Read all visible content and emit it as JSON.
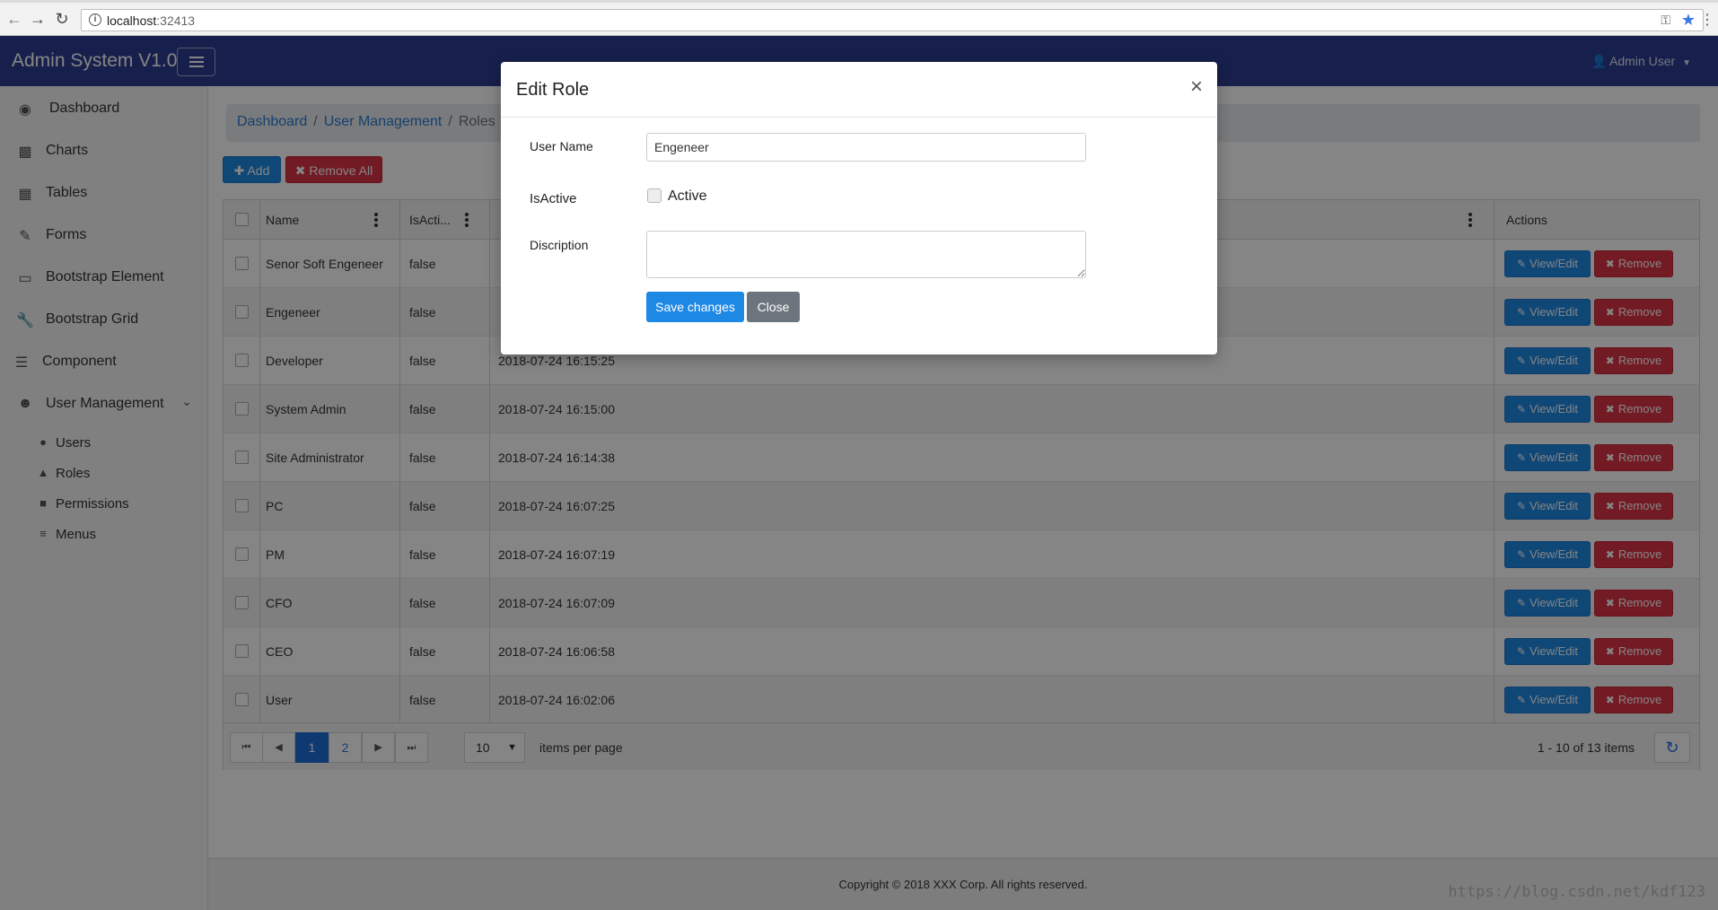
{
  "browser": {
    "url_host": "localhost",
    "url_port": ":32413",
    "back_icon": "back-arrow-icon",
    "forward_icon": "forward-arrow-icon",
    "reload_icon": "reload-icon"
  },
  "header": {
    "brand": "Admin System V1.0",
    "user": "Admin User"
  },
  "sidebar": {
    "items": [
      {
        "label": "Dashboard",
        "icon": "dashboard-icon"
      },
      {
        "label": "Charts",
        "icon": "bar-chart-icon"
      },
      {
        "label": "Tables",
        "icon": "table-icon"
      },
      {
        "label": "Forms",
        "icon": "edit-icon"
      },
      {
        "label": "Bootstrap Element",
        "icon": "desktop-icon"
      },
      {
        "label": "Bootstrap Grid",
        "icon": "wrench-icon"
      },
      {
        "label": "Component",
        "icon": "list-icon"
      },
      {
        "label": "User Management",
        "icon": "users-icon"
      }
    ],
    "subitems": [
      {
        "label": "Users",
        "icon": "user-icon"
      },
      {
        "label": "Roles",
        "icon": "sitemap-icon"
      },
      {
        "label": "Permissions",
        "icon": "lock-icon"
      },
      {
        "label": "Menus",
        "icon": "bars-icon"
      }
    ]
  },
  "breadcrumb": {
    "items": [
      "Dashboard",
      "User Management"
    ],
    "current": "Roles"
  },
  "toolbar": {
    "add_label": "Add",
    "remove_all_label": "Remove All"
  },
  "grid": {
    "columns": [
      "Name",
      "IsActi...",
      "Actions"
    ],
    "rows": [
      {
        "name": "Senor Soft Engeneer",
        "active": "false",
        "created": ""
      },
      {
        "name": "Engeneer",
        "active": "false",
        "created": ""
      },
      {
        "name": "Developer",
        "active": "false",
        "created": "2018-07-24 16:15:25"
      },
      {
        "name": "System Admin",
        "active": "false",
        "created": "2018-07-24 16:15:00"
      },
      {
        "name": "Site Administrator",
        "active": "false",
        "created": "2018-07-24 16:14:38"
      },
      {
        "name": "PC",
        "active": "false",
        "created": "2018-07-24 16:07:25"
      },
      {
        "name": "PM",
        "active": "false",
        "created": "2018-07-24 16:07:19"
      },
      {
        "name": "CFO",
        "active": "false",
        "created": "2018-07-24 16:07:09"
      },
      {
        "name": "CEO",
        "active": "false",
        "created": "2018-07-24 16:06:58"
      },
      {
        "name": "User",
        "active": "false",
        "created": "2018-07-24 16:02:06"
      }
    ],
    "view_edit_label": "View/Edit",
    "remove_label": "Remove"
  },
  "pager": {
    "pages": [
      "1",
      "2"
    ],
    "current_page": "1",
    "page_size": "10",
    "items_per_page_label": "items per page",
    "info": "1 - 10 of 13 items"
  },
  "footer": {
    "copyright": "Copyright © 2018 XXX Corp. All rights reserved.",
    "watermark": "https://blog.csdn.net/kdf123"
  },
  "modal": {
    "title": "Edit Role",
    "close_symbol": "×",
    "user_name_label": "User Name",
    "user_name_value": "Engeneer",
    "is_active_label": "IsActive",
    "active_checkbox_label": "Active",
    "active_checked": false,
    "description_label": "Discription",
    "description_value": "",
    "save_label": "Save changes",
    "close_label": "Close"
  },
  "colors": {
    "header_bg": "#2c3e93",
    "primary": "#1e88e5",
    "danger": "#dc3545",
    "close_button": "#6c757d"
  }
}
